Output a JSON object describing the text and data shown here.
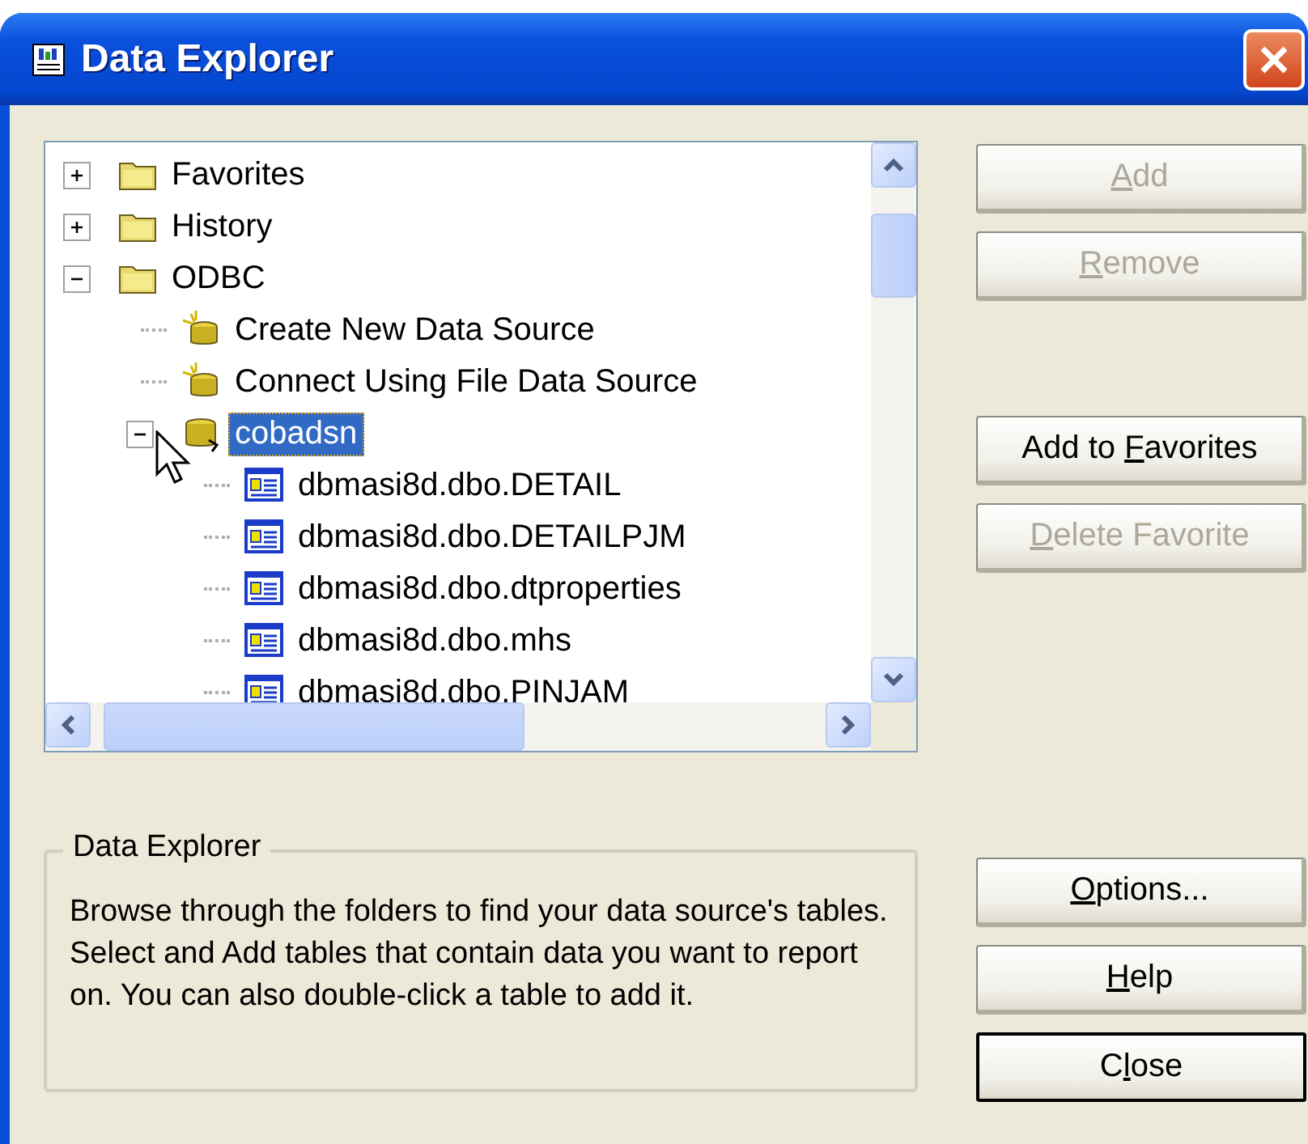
{
  "window": {
    "title": "Data Explorer"
  },
  "tree": [
    {
      "label": "Favorites",
      "kind": "folder",
      "expanded": false,
      "selected": false
    },
    {
      "label": "History",
      "kind": "folder",
      "expanded": false,
      "selected": false
    },
    {
      "label": "ODBC",
      "kind": "folder",
      "expanded": true,
      "selected": false,
      "children": [
        {
          "label": "Create New Data Source",
          "kind": "wizard",
          "selected": false
        },
        {
          "label": "Connect Using File Data Source",
          "kind": "wizard",
          "selected": false
        },
        {
          "label": "cobadsn",
          "kind": "database",
          "expanded": true,
          "selected": true,
          "children": [
            {
              "label": "dbmasi8d.dbo.DETAIL",
              "kind": "table",
              "selected": false
            },
            {
              "label": "dbmasi8d.dbo.DETAILPJM",
              "kind": "table",
              "selected": false
            },
            {
              "label": "dbmasi8d.dbo.dtproperties",
              "kind": "table",
              "selected": false
            },
            {
              "label": "dbmasi8d.dbo.mhs",
              "kind": "table",
              "selected": false
            },
            {
              "label": "dbmasi8d.dbo.PINJAM",
              "kind": "table",
              "selected": false
            }
          ]
        }
      ]
    }
  ],
  "top_buttons": [
    {
      "mnemonic": "A",
      "after": "dd",
      "disabled": true
    },
    {
      "mnemonic": "R",
      "after": "emove",
      "disabled": true
    }
  ],
  "favorite_buttons": [
    {
      "before": "Add to ",
      "mnemonic": "F",
      "after": "avorites",
      "disabled": false
    },
    {
      "mnemonic": "D",
      "after": "elete Favorite",
      "disabled": true
    }
  ],
  "info": {
    "title": "Data Explorer",
    "text": "Browse through the folders to find your data source's tables.  Select and Add tables that contain data you want to report on.  You can also double-click a table to add it."
  },
  "bottom_buttons": [
    {
      "mnemonic": "O",
      "after": "ptions...",
      "disabled": false,
      "default": false
    },
    {
      "mnemonic": "H",
      "after": "elp",
      "disabled": false,
      "default": false
    },
    {
      "before": "C",
      "mnemonic": "l",
      "after": "ose",
      "disabled": false,
      "default": true
    }
  ]
}
